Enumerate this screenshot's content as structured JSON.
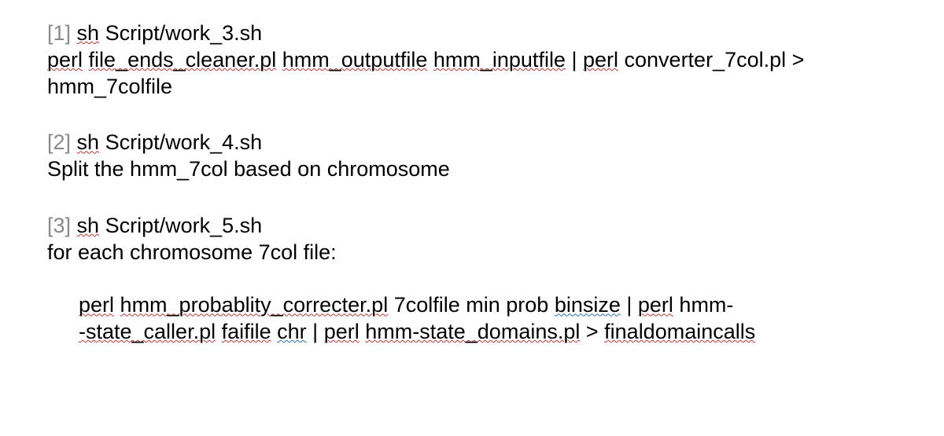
{
  "items": [
    {
      "num": "[1]",
      "sh_word": "sh",
      "header_rest": " Script/work_3.sh",
      "body_tokens": [
        {
          "t": "perl",
          "c": "sp-red"
        },
        {
          "t": " "
        },
        {
          "t": "file_ends_cleaner.pl",
          "c": "sp-red"
        },
        {
          "t": " "
        },
        {
          "t": "hmm_outputfile",
          "c": "sp-red"
        },
        {
          "t": " "
        },
        {
          "t": "hmm_inputfile",
          "c": "sp-red"
        },
        {
          "t": " | "
        },
        {
          "t": "perl",
          "c": "sp-red"
        },
        {
          "t": " converter_7col.pl > hmm_7colfile"
        }
      ]
    },
    {
      "num": "[2]",
      "sh_word": "sh",
      "header_rest": " Script/work_4.sh",
      "body_tokens": [
        {
          "t": "Split the hmm_7col based on chromosome"
        }
      ]
    },
    {
      "num": "[3]",
      "sh_word": "sh",
      "header_rest": " Script/work_5.sh",
      "body_tokens": [
        {
          "t": "for each chromosome 7col file:"
        }
      ],
      "sub_tokens": [
        {
          "t": "perl",
          "c": "sp-red"
        },
        {
          "t": " "
        },
        {
          "t": "hmm_probablity_correcter.pl",
          "c": "sp-red"
        },
        {
          "t": " 7colfile min prob "
        },
        {
          "t": "binsize",
          "c": "sp-blue"
        },
        {
          "t": " | "
        },
        {
          "t": "perl",
          "c": "sp-red"
        },
        {
          "t": " hmm-"
        },
        {
          "br": true
        },
        {
          "t": "-state_caller.pl",
          "c": "sp-red"
        },
        {
          "t": " "
        },
        {
          "t": "faifile",
          "c": "sp-red"
        },
        {
          "t": " "
        },
        {
          "t": "chr",
          "c": "sp-blue"
        },
        {
          "t": " | "
        },
        {
          "t": "perl",
          "c": "sp-red"
        },
        {
          "t": " "
        },
        {
          "t": "hmm-state_domains.pl",
          "c": "sp-red"
        },
        {
          "t": " > "
        },
        {
          "t": "finaldomaincalls",
          "c": "sp-red"
        }
      ]
    }
  ]
}
